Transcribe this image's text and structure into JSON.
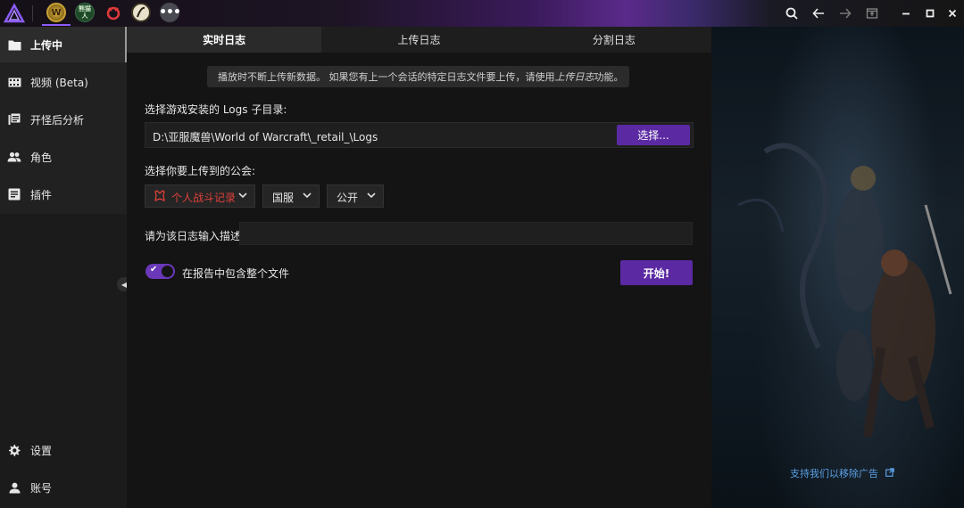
{
  "topbar": {
    "game_icons": [
      "wow-icon",
      "game-icon-2",
      "game-icon-3",
      "game-icon-4",
      "more-icon"
    ],
    "game2_text": "熊猫人",
    "wow_text": "W",
    "right_icons": [
      "search-icon",
      "back-icon",
      "forward-icon",
      "window-icon",
      "minimize-icon",
      "maximize-icon",
      "close-icon"
    ]
  },
  "sidebar": {
    "items": [
      {
        "label": "上传中",
        "icon": "folder-icon",
        "active": true
      },
      {
        "label": "视频 (Beta)",
        "icon": "film-icon",
        "active": false
      },
      {
        "label": "开怪后分析",
        "icon": "list-icon",
        "active": false
      },
      {
        "label": "角色",
        "icon": "people-icon",
        "active": false
      },
      {
        "label": "插件",
        "icon": "plugin-icon",
        "active": false
      }
    ],
    "bottom": [
      {
        "label": "设置",
        "icon": "gear-icon"
      },
      {
        "label": "账号",
        "icon": "person-icon"
      }
    ]
  },
  "tabs": [
    {
      "label": "实时日志",
      "active": true
    },
    {
      "label": "上传日志",
      "active": false
    },
    {
      "label": "分割日志",
      "active": false
    }
  ],
  "info": {
    "text_before": "播放时不断上传新数据。 如果您有上一个会话的特定日志文件要上传，请使用",
    "italic": "上传日志",
    "text_after": "功能。"
  },
  "logs": {
    "label": "选择游戏安装的 Logs 子目录:",
    "path": "D:\\亚服魔兽\\World of Warcraft\\_retail_\\Logs",
    "choose_button": "选择..."
  },
  "guild": {
    "label": "选择你要上传到的公会:",
    "selected_guild": "个人战斗记录",
    "region": "国服",
    "visibility": "公开"
  },
  "description": {
    "label": "请为该日志输入描述",
    "value": ""
  },
  "include_file": {
    "label": "在报告中包含整个文件",
    "enabled": true
  },
  "start_button": "开始!",
  "ad_link": "支持我们以移除广告",
  "colors": {
    "accent": "#5b2aa3",
    "link": "#5aa0e6",
    "guild_red": "#e0403a"
  }
}
